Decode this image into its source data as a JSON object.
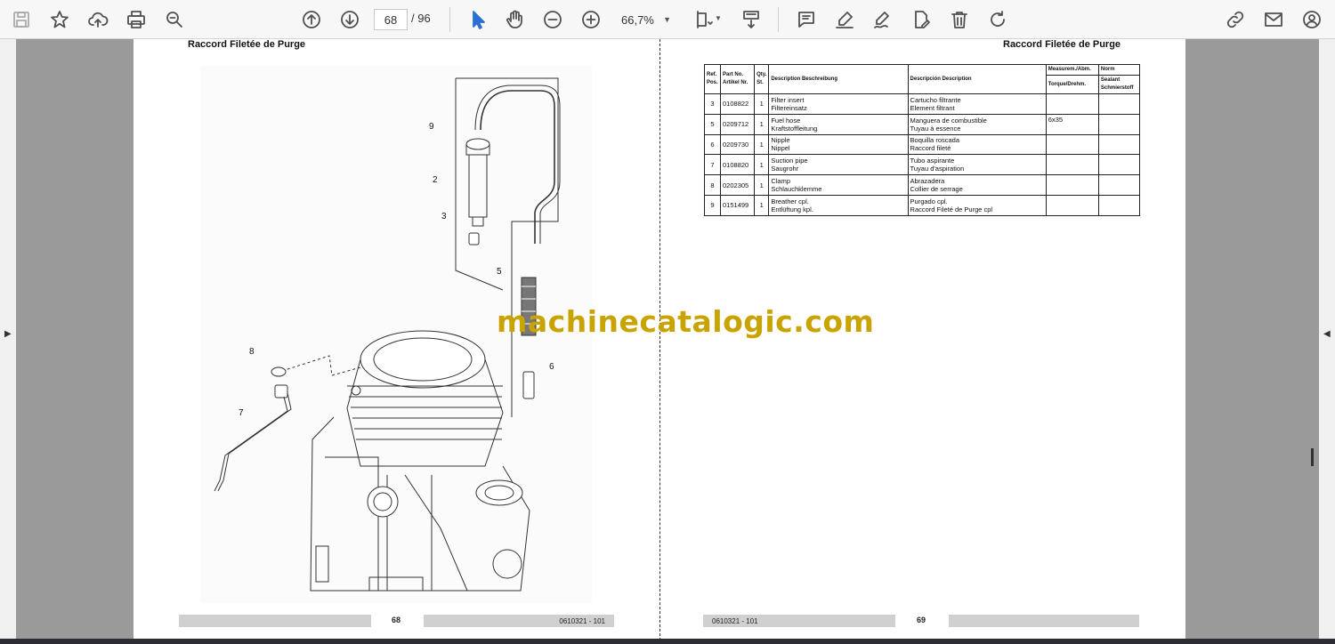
{
  "toolbar": {
    "current_page": "68",
    "total_pages": "/ 96",
    "zoom": "66,7%"
  },
  "left_page": {
    "title": "Raccord Filetée de Purge",
    "page_number": "68",
    "doc_code": "0610321 - 101",
    "callouts": [
      "9",
      "2",
      "3",
      "5",
      "8",
      "6",
      "7"
    ]
  },
  "right_page": {
    "title": "Raccord Filetée de Purge",
    "page_number": "69",
    "doc_code": "0610321 - 101",
    "table": {
      "headers": {
        "ref": "Ref. Pos.",
        "part_no": "Part No. Artikel Nr.",
        "qty": "Qty. St.",
        "desc_en_de": "Description Beschreibung",
        "desc_es_fr": "Descripción Description",
        "measure": "Measurem./Abm.",
        "torque": "Torque/Drehm.",
        "norm": "Norm",
        "sealant": "Sealant Schmierstoff"
      },
      "rows": [
        {
          "ref": "3",
          "part": "0108822",
          "qty": "1",
          "d1": "Filter insert",
          "d2": "Filtereinsatz",
          "d3": "Cartucho filtrante",
          "d4": "Element filtrant",
          "measure": ""
        },
        {
          "ref": "5",
          "part": "0209712",
          "qty": "1",
          "d1": "Fuel hose",
          "d2": "Kraftstoffleitung",
          "d3": "Manguera de combustible",
          "d4": "Tuyau à essence",
          "measure": "6x35"
        },
        {
          "ref": "6",
          "part": "0209730",
          "qty": "1",
          "d1": "Nipple",
          "d2": "Nippel",
          "d3": "Boquilla roscada",
          "d4": "Raccord fileté",
          "measure": ""
        },
        {
          "ref": "7",
          "part": "0108820",
          "qty": "1",
          "d1": "Suction pipe",
          "d2": "Saugrohr",
          "d3": "Tubo aspirante",
          "d4": "Tuyau d'aspiration",
          "measure": ""
        },
        {
          "ref": "8",
          "part": "0202305",
          "qty": "1",
          "d1": "Clamp",
          "d2": "Schlauchklemme",
          "d3": "Abrazadera",
          "d4": "Collier de serrage",
          "measure": ""
        },
        {
          "ref": "9",
          "part": "0151499",
          "qty": "1",
          "d1": "Breather cpl.",
          "d2": "Entlüftung kpl.",
          "d3": "Purgado cpl.",
          "d4": "Raccord Fileté de Purge cpl",
          "measure": ""
        }
      ]
    }
  },
  "watermark": "machinecatalogic.com",
  "colors": {
    "accent": "#2b6fd6",
    "watermark": "#c9a400",
    "viewer_bg": "#9a9a9a"
  }
}
